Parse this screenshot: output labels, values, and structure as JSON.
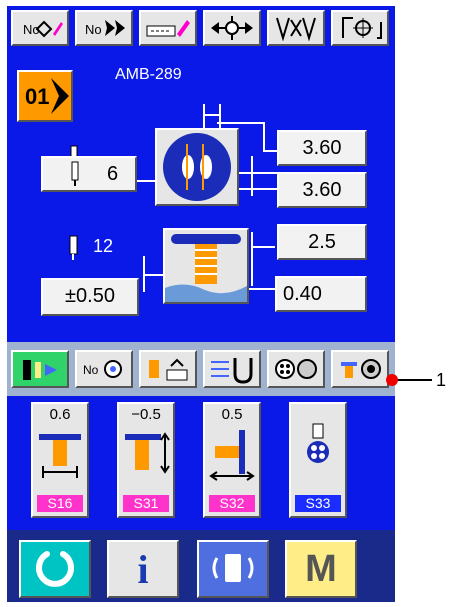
{
  "toolbar": {
    "buttons": [
      {
        "name": "pattern-number-edit-icon"
      },
      {
        "name": "pattern-number-select-icon"
      },
      {
        "name": "data-edit-icon"
      },
      {
        "name": "move-position-icon"
      },
      {
        "name": "thread-cut-icon"
      },
      {
        "name": "reference-point-icon"
      }
    ]
  },
  "pattern": {
    "number": "01",
    "name": "AMB-289"
  },
  "settings": {
    "needle_count": "6",
    "stitch_width_x": "3.60",
    "stitch_width_y": "3.60",
    "wrap_count": "12",
    "wrap_height": "2.5",
    "shank_offset": "±0.50",
    "shank_height": "0.40"
  },
  "function_row": {
    "buttons": [
      {
        "name": "needle-thread-icon"
      },
      {
        "name": "pattern-search-icon"
      },
      {
        "name": "counter-icon"
      },
      {
        "name": "needle-reverse-icon"
      },
      {
        "name": "bobbin-icon"
      },
      {
        "name": "winder-icon"
      }
    ]
  },
  "callout": "1",
  "tiles": [
    {
      "value": "0.6",
      "label": "S16"
    },
    {
      "value": "−0.5",
      "label": "S31"
    },
    {
      "value": "0.5",
      "label": "S32"
    },
    {
      "value": "",
      "label": "S33"
    }
  ],
  "bottom": {
    "ready_icon": "ready-icon",
    "info_label": "i",
    "comm_icon": "communication-icon",
    "mode_label": "M"
  },
  "colors": {
    "screen": "#0a18e8",
    "pattern_number": "#ff9900",
    "tile_label_pink": "#ff33cc",
    "tile_label_blue": "#1a2cff",
    "ready_button": "#00c4c4",
    "mode_button": "#ffee88"
  }
}
